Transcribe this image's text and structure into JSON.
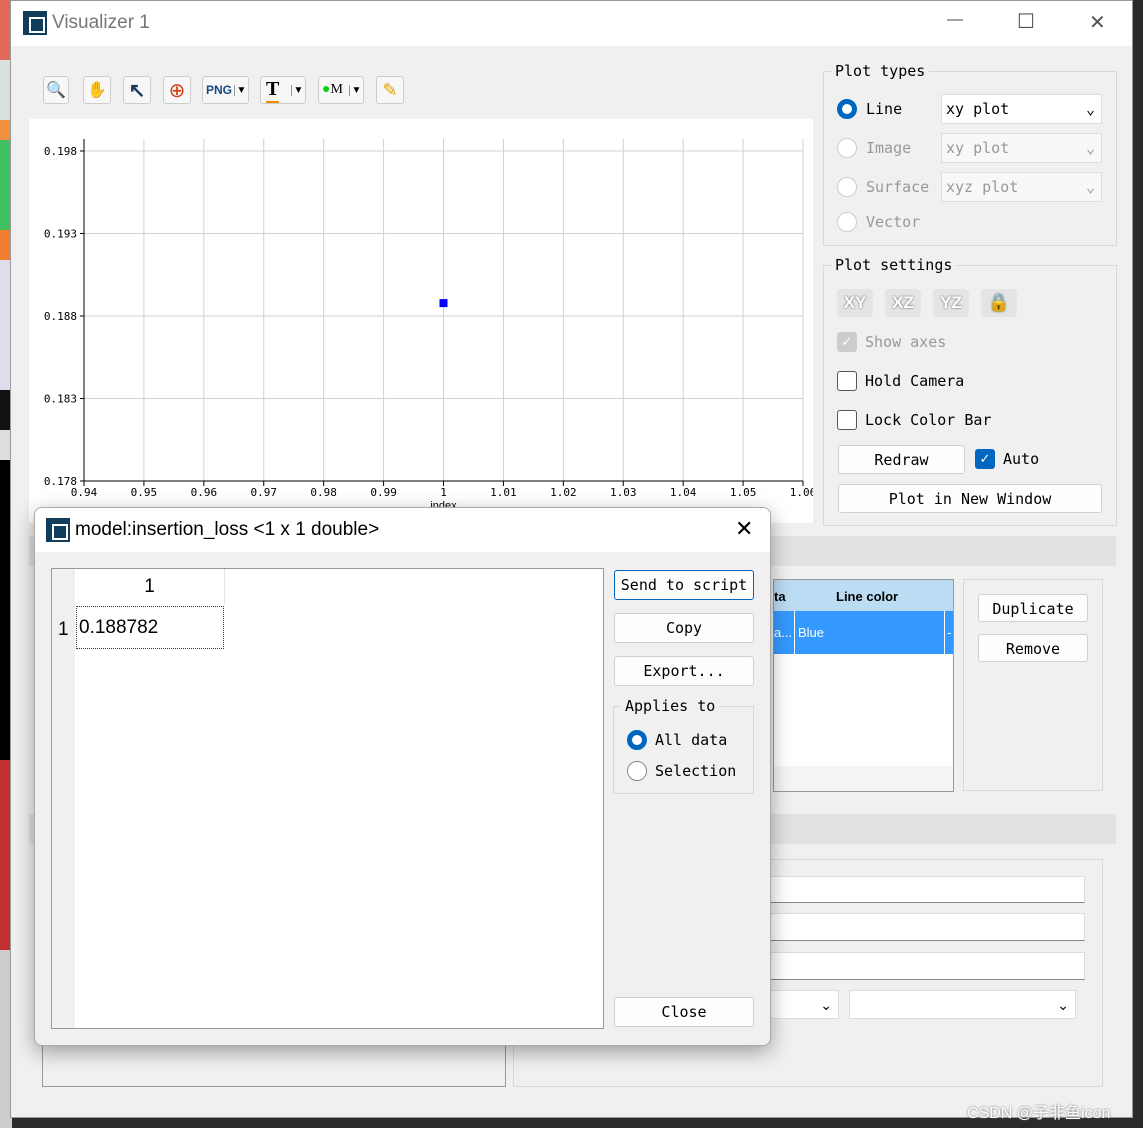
{
  "window": {
    "title": "Visualizer 1",
    "minimize": "—",
    "maximize": "☐",
    "close": "✕"
  },
  "toolbar": [
    {
      "name": "zoom-icon",
      "glyph": "🔍"
    },
    {
      "name": "pan-hand-icon",
      "glyph": "✋"
    },
    {
      "name": "select-arrow-icon",
      "glyph": "↖"
    },
    {
      "name": "zoom-extents-icon",
      "glyph": "⊕"
    },
    {
      "name": "png-export-icon",
      "glyph": "PNG"
    },
    {
      "name": "text-annotation-icon",
      "glyph": "T"
    },
    {
      "name": "marker-icon",
      "glyph": "M"
    },
    {
      "name": "pencil-icon",
      "glyph": "✎"
    }
  ],
  "plot": {
    "xlabel": "index",
    "xticks": [
      "0.94",
      "0.95",
      "0.96",
      "0.97",
      "0.98",
      "0.99",
      "1",
      "1.01",
      "1.02",
      "1.03",
      "1.04",
      "1.05",
      "1.06"
    ],
    "yticks": [
      "0.198",
      "0.193",
      "0.188",
      "0.183",
      "0.178"
    ],
    "xlim": [
      0.94,
      1.06
    ],
    "ylim": [
      0.178,
      0.198
    ],
    "points": [
      {
        "x": 1,
        "y": 0.188782
      }
    ],
    "marker_color": "#0000ff"
  },
  "plot_types": {
    "label": "Plot types",
    "items": [
      {
        "label": "Line",
        "selected": true,
        "select": "xy plot",
        "enabled": true
      },
      {
        "label": "Image",
        "selected": false,
        "select": "xy plot",
        "enabled": false
      },
      {
        "label": "Surface",
        "selected": false,
        "select": "xyz plot",
        "enabled": false
      },
      {
        "label": "Vector",
        "selected": false,
        "enabled": false
      }
    ]
  },
  "plot_settings": {
    "label": "Plot settings",
    "view_buttons": [
      "XY",
      "XZ",
      "YZ",
      "🔒"
    ],
    "show_axes": "Show axes",
    "hold_camera": "Hold Camera",
    "lock_color_bar": "Lock Color Bar",
    "redraw": "Redraw",
    "auto": "Auto",
    "plot_new_window": "Plot in New Window"
  },
  "lines_table": {
    "headers": [
      "ta",
      "Line color"
    ],
    "rows": [
      [
        "a...",
        "Blue",
        "-"
      ]
    ]
  },
  "line_buttons": {
    "duplicate": "Duplicate",
    "remove": "Remove"
  },
  "dialog": {
    "title": "model:insertion_loss <1 x 1 double>",
    "close": "✕",
    "col_header": "1",
    "row_header": "1",
    "value": "0.188782",
    "send": "Send to script",
    "copy": "Copy",
    "export": "Export...",
    "applies_to": "Applies to",
    "all_data": "All data",
    "selection": "Selection",
    "close_button": "Close"
  },
  "watermark": "CSDN @子非鱼icon",
  "colors": {
    "accent": "#0067c0",
    "selected_row": "#3399ff",
    "header_row": "#bcdcf4"
  }
}
